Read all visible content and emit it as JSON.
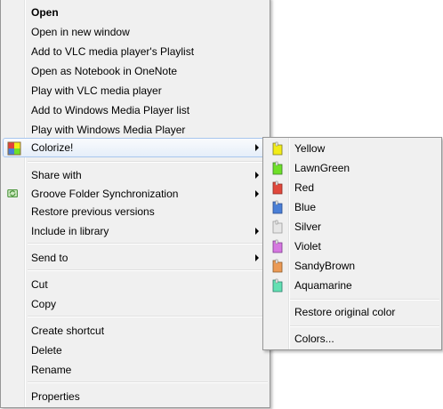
{
  "main_menu": {
    "open": "Open",
    "open_new_window": "Open in new window",
    "add_vlc_playlist": "Add to VLC media player's Playlist",
    "open_onenote": "Open as Notebook in OneNote",
    "play_vlc": "Play with VLC media player",
    "add_wmp_list": "Add to Windows Media Player list",
    "play_wmp": "Play with Windows Media Player",
    "colorize": "Colorize!",
    "share_with": "Share with",
    "groove_sync": "Groove Folder Synchronization",
    "restore_versions": "Restore previous versions",
    "include_library": "Include in library",
    "send_to": "Send to",
    "cut": "Cut",
    "copy": "Copy",
    "create_shortcut": "Create shortcut",
    "delete": "Delete",
    "rename": "Rename",
    "properties": "Properties"
  },
  "colorize_submenu": {
    "colors": [
      {
        "label": "Yellow",
        "icon": "yellow-folder-icon",
        "color": "#f2ec17"
      },
      {
        "label": "LawnGreen",
        "icon": "lawngreen-folder-icon",
        "color": "#6fe028"
      },
      {
        "label": "Red",
        "icon": "red-folder-icon",
        "color": "#e0483c"
      },
      {
        "label": "Blue",
        "icon": "blue-folder-icon",
        "color": "#4a7fd6"
      },
      {
        "label": "Silver",
        "icon": "silver-folder-icon",
        "color": "#e6e6e6"
      },
      {
        "label": "Violet",
        "icon": "violet-folder-icon",
        "color": "#d678e0"
      },
      {
        "label": "SandyBrown",
        "icon": "sandybrown-folder-icon",
        "color": "#eb9a55"
      },
      {
        "label": "Aquamarine",
        "icon": "aquamarine-folder-icon",
        "color": "#63e0b2"
      }
    ],
    "restore_original": "Restore original color",
    "colors_more": "Colors..."
  }
}
